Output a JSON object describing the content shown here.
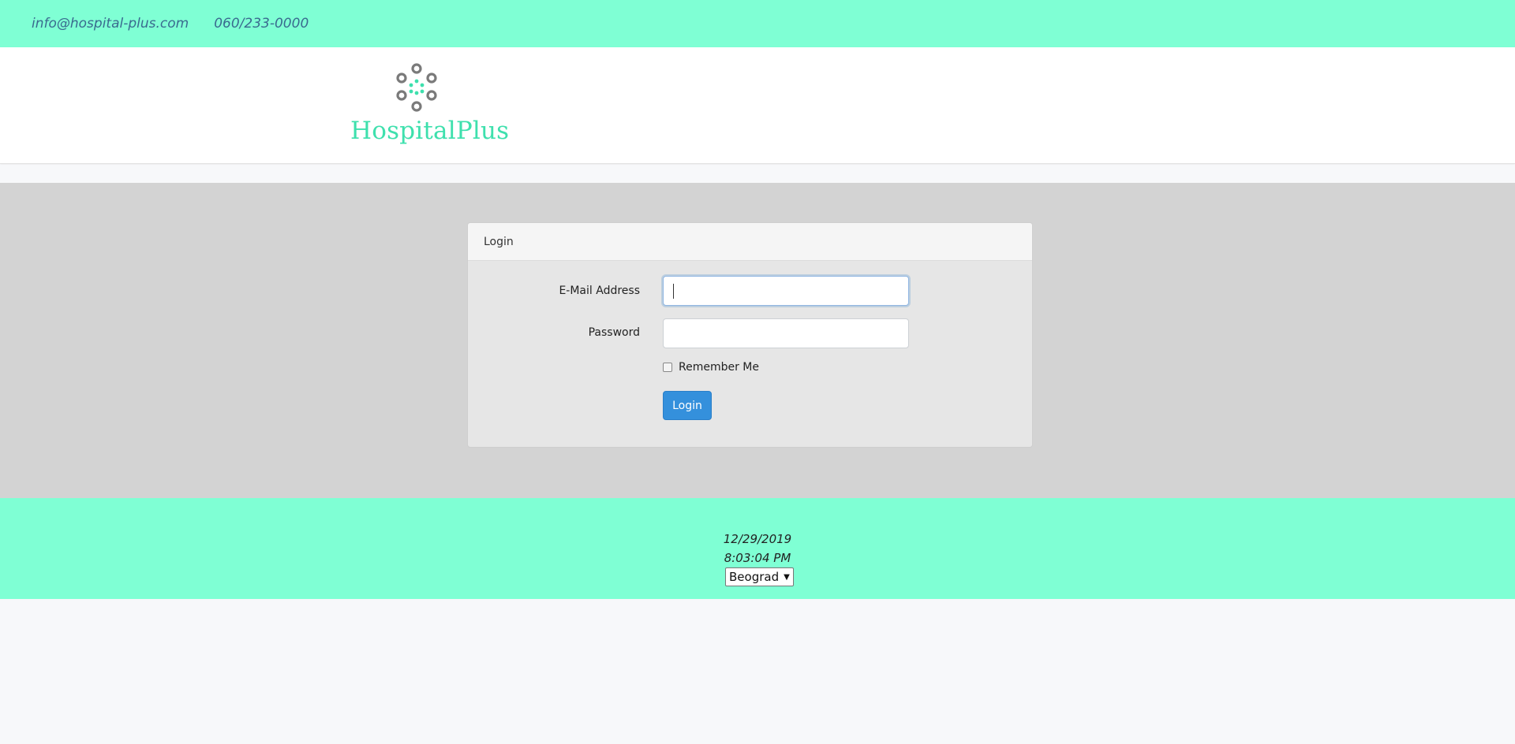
{
  "topbar": {
    "email": "info@hospital-plus.com",
    "phone": "060/233-0000"
  },
  "brand": {
    "name": "HospitalPlus",
    "logo_icon": "hospitalplus-logo-icon",
    "accent": "#3ee0ad"
  },
  "login": {
    "title": "Login",
    "email_label": "E-Mail Address",
    "email_value": "",
    "password_label": "Password",
    "password_value": "",
    "remember_label": "Remember Me",
    "remember_checked": false,
    "submit_label": "Login"
  },
  "footer": {
    "date": "12/29/2019",
    "time": "8:03:04 PM",
    "city_selected": "Beograd"
  },
  "colors": {
    "topbar_bg": "#7fffd4",
    "main_bg": "#d3d3d3",
    "button_bg": "#3490dc"
  }
}
